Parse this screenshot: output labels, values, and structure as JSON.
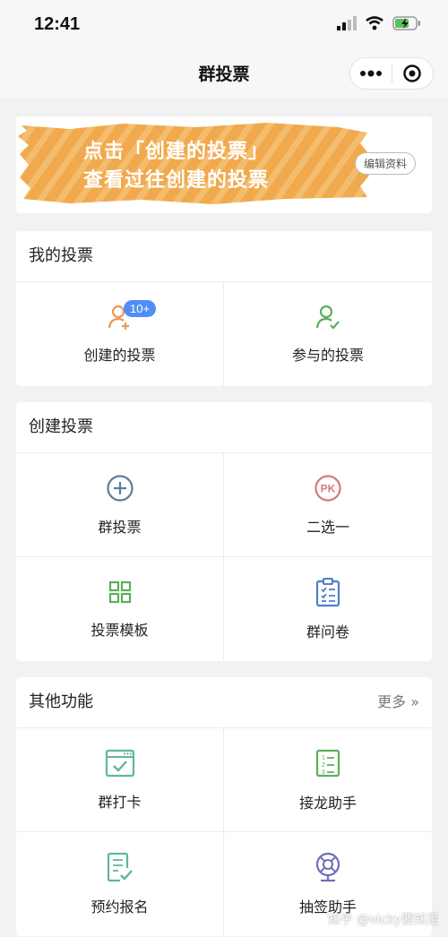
{
  "status_bar": {
    "time": "12:41"
  },
  "nav": {
    "title": "群投票"
  },
  "banner": {
    "line1": "点击「创建的投票」",
    "line2": "查看过往创建的投票",
    "edit_label": "编辑资料"
  },
  "my_votes": {
    "title": "我的投票",
    "items": [
      {
        "label": "创建的投票",
        "badge": "10+"
      },
      {
        "label": "参与的投票"
      }
    ]
  },
  "create_vote": {
    "title": "创建投票",
    "items": [
      {
        "label": "群投票"
      },
      {
        "label": "二选一",
        "icon_text": "PK"
      },
      {
        "label": "投票模板"
      },
      {
        "label": "群问卷"
      }
    ]
  },
  "other_features": {
    "title": "其他功能",
    "more_label": "更多 »",
    "items": [
      {
        "label": "群打卡"
      },
      {
        "label": "接龙助手"
      },
      {
        "label": "预约报名"
      },
      {
        "label": "抽签助手"
      }
    ]
  },
  "watermark": "知乎 @vicky要知足",
  "colors": {
    "banner_orange": "#f0a94c",
    "orange_icon": "#e89a55",
    "green_icon": "#5cae5c",
    "blue_gray_icon": "#5a7fa0",
    "pk_red": "#d87a7a",
    "badge_blue": "#4f8ef7",
    "lottery_purple": "#6c6fb5"
  }
}
